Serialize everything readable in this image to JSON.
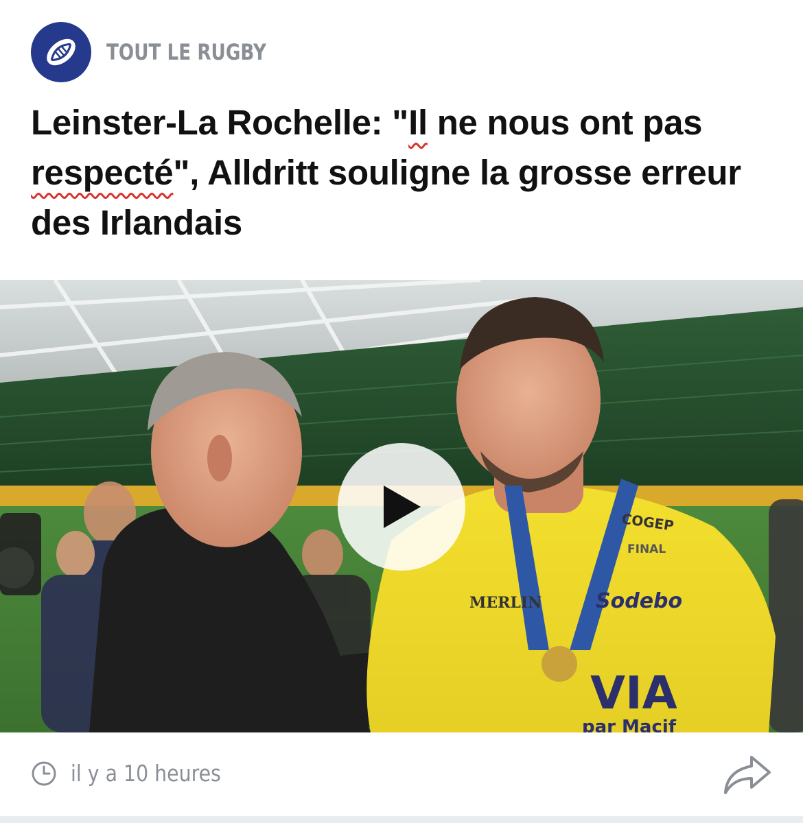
{
  "source": {
    "logo_icon": "rugby-ball-icon",
    "brand_color": "#253a8c",
    "name": "TOUT LE RUGBY"
  },
  "article": {
    "headline_parts": [
      "Leinster-La Rochelle: \"",
      "Il",
      " ne nous ont pas ",
      "respecté",
      "\", Alldritt souligne la grosse erreur des Irlandais"
    ],
    "media": {
      "type": "video",
      "play_icon": "play-icon",
      "jersey_sponsors": [
        "COGEP",
        "FINAL",
        "MERLIN",
        "Sodebo",
        "VIA",
        "par Macif"
      ]
    }
  },
  "footer": {
    "time_icon": "clock-icon",
    "time_text": "il y a 10 heures",
    "share_icon": "share-arrow-icon"
  },
  "colors": {
    "text_dark": "#111111",
    "text_muted": "#8a8f96",
    "underline_red": "#d9332b",
    "jersey_yellow": "#f2dc2b"
  }
}
